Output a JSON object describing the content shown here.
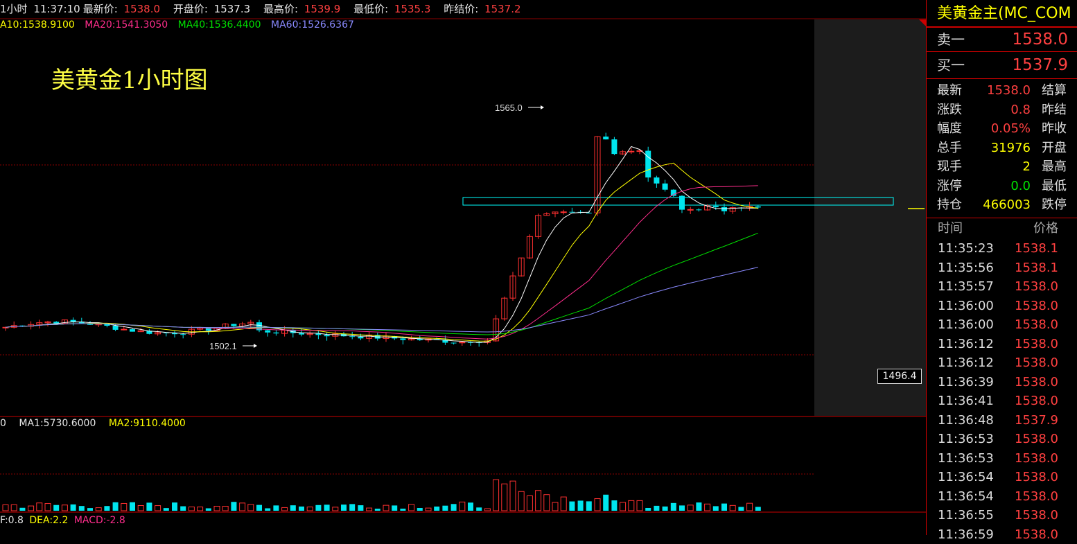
{
  "info": {
    "period": "1小时",
    "time": "11:37:10",
    "last_label": "最新价:",
    "last_value": "1538.0",
    "open_label": "开盘价:",
    "open_value": "1537.3",
    "high_label": "最高价:",
    "high_value": "1539.9",
    "low_label": "最低价:",
    "low_value": "1535.3",
    "prev_label": "昨结价:",
    "prev_value": "1537.2"
  },
  "ma": {
    "ma10": "A10:1538.9100",
    "ma20": "MA20:1541.3050",
    "ma40": "MA40:1536.4400",
    "ma60": "MA60:1526.6367"
  },
  "chart_title": "美黄金1小时图",
  "annotations": {
    "high": "1565.0",
    "low": "1502.1",
    "axis_price": "1496.4"
  },
  "volume": {
    "prefix": "0",
    "ma1": "MA1:5730.6000",
    "ma2": "MA2:9110.4000"
  },
  "macd": {
    "diff": "F:0.8",
    "dea": "DEA:2.2",
    "macd": "MACD:-2.8"
  },
  "panel": {
    "title": "美黄金主(MC_COM",
    "sell_label": "卖一",
    "sell_value": "1538.0",
    "buy_label": "买一",
    "buy_value": "1537.9",
    "stats": [
      {
        "label": "最新",
        "value": "1538.0",
        "label2": "结算",
        "color": "#ff4040"
      },
      {
        "label": "涨跌",
        "value": "0.8",
        "label2": "昨结",
        "color": "#ff4040"
      },
      {
        "label": "幅度",
        "value": "0.05%",
        "label2": "昨收",
        "color": "#ff4040"
      },
      {
        "label": "总手",
        "value": "31976",
        "label2": "开盘",
        "color": "#ffff00"
      },
      {
        "label": "现手",
        "value": "2",
        "label2": "最高",
        "color": "#ffff00"
      },
      {
        "label": "涨停",
        "value": "0.0",
        "label2": "最低",
        "color": "#00e000"
      },
      {
        "label": "持仓",
        "value": "466003",
        "label2": "跌停",
        "color": "#ffff00"
      }
    ],
    "tick_time_header": "时间",
    "tick_price_header": "价格",
    "ticks": [
      {
        "time": "11:35:23",
        "price": "1538.1"
      },
      {
        "time": "11:35:56",
        "price": "1538.1"
      },
      {
        "time": "11:35:57",
        "price": "1538.0"
      },
      {
        "time": "11:36:00",
        "price": "1538.0"
      },
      {
        "time": "11:36:00",
        "price": "1538.0"
      },
      {
        "time": "11:36:12",
        "price": "1538.0"
      },
      {
        "time": "11:36:12",
        "price": "1538.0"
      },
      {
        "time": "11:36:39",
        "price": "1538.0"
      },
      {
        "time": "11:36:41",
        "price": "1538.0"
      },
      {
        "time": "11:36:48",
        "price": "1537.9"
      },
      {
        "time": "11:36:53",
        "price": "1538.0"
      },
      {
        "time": "11:36:53",
        "price": "1538.0"
      },
      {
        "time": "11:36:54",
        "price": "1538.0"
      },
      {
        "time": "11:36:54",
        "price": "1538.0"
      },
      {
        "time": "11:36:55",
        "price": "1538.0"
      },
      {
        "time": "11:36:59",
        "price": "1538.0"
      }
    ]
  },
  "colors": {
    "up": "#ff3030",
    "down": "#00e5ee",
    "ma5": "#ffffff",
    "ma10": "#ffff00",
    "ma20": "#ff2d8c",
    "ma40": "#00e000",
    "ma60": "#8a8aff"
  }
}
